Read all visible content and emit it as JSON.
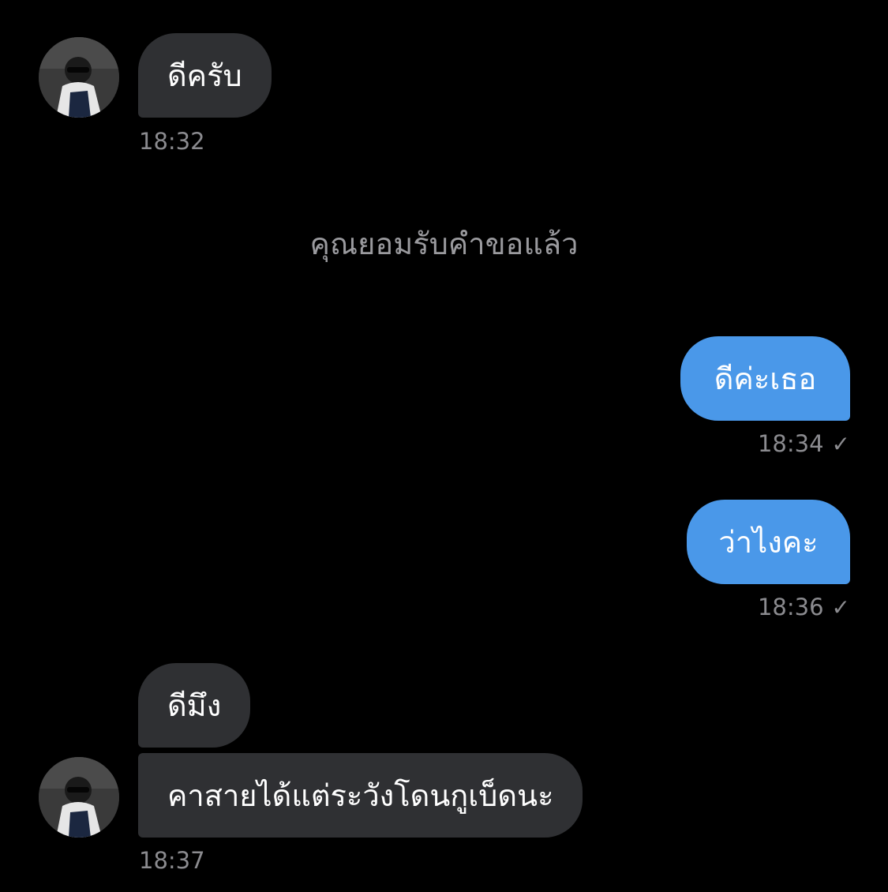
{
  "conversation": {
    "messages": [
      {
        "direction": "incoming",
        "text": "ดีครับ",
        "time": "18:32"
      },
      {
        "direction": "outgoing",
        "text": "ดีค่ะเธอ",
        "time": "18:34",
        "status_icon": "check-icon"
      },
      {
        "direction": "outgoing",
        "text": "ว่าไงคะ",
        "time": "18:36",
        "status_icon": "check-icon"
      },
      {
        "direction": "incoming",
        "text": "ดีมึง"
      },
      {
        "direction": "incoming",
        "text": "คาสายได้แต่ระวังโดนกูเบ็ดนะ",
        "time": "18:37"
      }
    ],
    "system_notice": "คุณยอมรับคำขอแล้ว",
    "check_glyph": "✓"
  },
  "colors": {
    "background": "#000000",
    "incoming_bubble": "#2f3033",
    "outgoing_bubble": "#4a98e9",
    "meta_text": "#8b8b8f"
  }
}
